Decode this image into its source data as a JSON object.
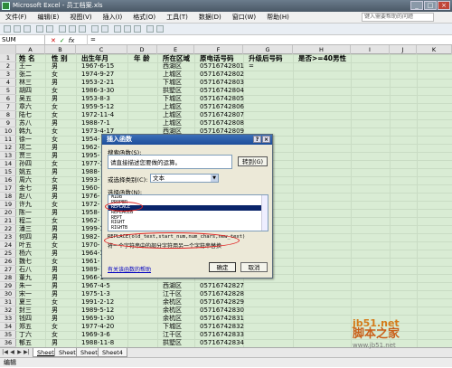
{
  "window": {
    "title": "Microsoft Excel - 员工档案.xls",
    "buttons": [
      "_",
      "□",
      "×"
    ]
  },
  "menu": {
    "items": [
      "文件(F)",
      "编辑(E)",
      "视图(V)",
      "插入(I)",
      "格式(O)",
      "工具(T)",
      "数据(D)",
      "窗口(W)",
      "帮助(H)"
    ],
    "help_placeholder": "键入需要帮助的问题"
  },
  "formula_bar": {
    "name_box": "SUM",
    "cancel": "✕",
    "enter": "✓",
    "fx": "fx",
    "content": "="
  },
  "columns": [
    "A",
    "B",
    "C",
    "D",
    "E",
    "F",
    "G",
    "H",
    "I",
    "J",
    "K"
  ],
  "row_numbers": [
    "1",
    "2",
    "3",
    "4",
    "5",
    "6",
    "7",
    "8",
    "9",
    "10",
    "11",
    "12",
    "13",
    "14",
    "15",
    "16",
    "17",
    "18",
    "19",
    "20",
    "21",
    "22",
    "23",
    "24",
    "25",
    "26",
    "27",
    "28",
    "29",
    "30",
    "31",
    "32",
    "33",
    "34",
    "35",
    "36"
  ],
  "header": {
    "a": "姓 名",
    "b": "性 别",
    "c": "出生年月",
    "d": "年 龄",
    "e": "所在区域",
    "f": "原电话号码",
    "g": "升级后号码",
    "h": "是否>=40男性"
  },
  "rows": [
    {
      "a": "王一",
      "b": "男",
      "c": "1967-6-15",
      "e": "西湖区",
      "f": "05716742801",
      "g": "="
    },
    {
      "a": "张二",
      "b": "女",
      "c": "1974-9-27",
      "e": "上城区",
      "f": "05716742802",
      "g": ""
    },
    {
      "a": "林三",
      "b": "男",
      "c": "1953-2-21",
      "e": "下城区",
      "f": "05716742803",
      "g": ""
    },
    {
      "a": "胡四",
      "b": "女",
      "c": "1986-3-30",
      "e": "拱墅区",
      "f": "05716742804",
      "g": ""
    },
    {
      "a": "吴五",
      "b": "男",
      "c": "1953-8-3",
      "e": "下城区",
      "f": "05716742805",
      "g": ""
    },
    {
      "a": "章六",
      "b": "女",
      "c": "1959-5-12",
      "e": "上城区",
      "f": "05716742806",
      "g": ""
    },
    {
      "a": "陆七",
      "b": "女",
      "c": "1972-11-4",
      "e": "上城区",
      "f": "05716742807",
      "g": ""
    },
    {
      "a": "苏八",
      "b": "男",
      "c": "1988-7-1",
      "e": "上城区",
      "f": "05716742808",
      "g": ""
    },
    {
      "a": "韩九",
      "b": "女",
      "c": "1973-4-17",
      "e": "西湖区",
      "f": "05716742809",
      "g": ""
    },
    {
      "a": "徐一",
      "b": "女",
      "c": "1954-",
      "e": "",
      "f": "",
      "g": ""
    },
    {
      "a": "项二",
      "b": "男",
      "c": "1962-",
      "e": "",
      "f": "",
      "g": ""
    },
    {
      "a": "贾三",
      "b": "男",
      "c": "1995-",
      "e": "",
      "f": "",
      "g": ""
    },
    {
      "a": "孙四",
      "b": "女",
      "c": "1977-1",
      "e": "",
      "f": "",
      "g": ""
    },
    {
      "a": "姚五",
      "b": "男",
      "c": "1988-",
      "e": "",
      "f": "",
      "g": ""
    },
    {
      "a": "周六",
      "b": "女",
      "c": "1993-",
      "e": "",
      "f": "",
      "g": ""
    },
    {
      "a": "金七",
      "b": "男",
      "c": "1960-",
      "e": "",
      "f": "",
      "g": ""
    },
    {
      "a": "赵八",
      "b": "男",
      "c": "1976-",
      "e": "",
      "f": "",
      "g": ""
    },
    {
      "a": "许九",
      "b": "女",
      "c": "1972-",
      "e": "",
      "f": "",
      "g": ""
    },
    {
      "a": "陈一",
      "b": "男",
      "c": "1958-",
      "e": "",
      "f": "",
      "g": ""
    },
    {
      "a": "程二",
      "b": "女",
      "c": "1962-",
      "e": "",
      "f": "",
      "g": ""
    },
    {
      "a": "潘三",
      "b": "男",
      "c": "1999-1",
      "e": "",
      "f": "",
      "g": ""
    },
    {
      "a": "何四",
      "b": "男",
      "c": "1982-",
      "e": "",
      "f": "",
      "g": ""
    },
    {
      "a": "叶五",
      "b": "女",
      "c": "1970-",
      "e": "",
      "f": "",
      "g": ""
    },
    {
      "a": "杨六",
      "b": "男",
      "c": "1964-1",
      "e": "",
      "f": "",
      "g": ""
    },
    {
      "a": "魏七",
      "b": "女",
      "c": "1961-",
      "e": "",
      "f": "",
      "g": ""
    },
    {
      "a": "石八",
      "b": "男",
      "c": "1989-",
      "e": "",
      "f": "",
      "g": ""
    },
    {
      "a": "董九",
      "b": "男",
      "c": "1966-1",
      "e": "",
      "f": "",
      "g": ""
    },
    {
      "a": "朱一",
      "b": "男",
      "c": "1967-4-5",
      "e": "西湖区",
      "f": "05716742827",
      "g": ""
    },
    {
      "a": "宋一",
      "b": "男",
      "c": "1975-1-3",
      "e": "江干区",
      "f": "05716742828",
      "g": ""
    },
    {
      "a": "夏三",
      "b": "女",
      "c": "1991-2-12",
      "e": "余杭区",
      "f": "05716742829",
      "g": ""
    },
    {
      "a": "封三",
      "b": "男",
      "c": "1989-5-12",
      "e": "余杭区",
      "f": "05716742830",
      "g": ""
    },
    {
      "a": "钱四",
      "b": "男",
      "c": "1969-1-30",
      "e": "余杭区",
      "f": "05716742831",
      "g": ""
    },
    {
      "a": "郑五",
      "b": "女",
      "c": "1977-4-20",
      "e": "下城区",
      "f": "05716742832",
      "g": ""
    },
    {
      "a": "丁六",
      "b": "女",
      "c": "1969-3-6",
      "e": "江干区",
      "f": "05716742833",
      "g": ""
    },
    {
      "a": "郁五",
      "b": "男",
      "c": "1988-11-8",
      "e": "拱墅区",
      "f": "05716742834",
      "g": ""
    },
    {
      "a": "刘八",
      "b": "女",
      "c": "1964-4-1",
      "e": "余杭区",
      "f": "05716742835",
      "g": ""
    }
  ],
  "sheet_tabs": [
    "Sheet1",
    "Sheet2",
    "Sheet3",
    "Sheet4"
  ],
  "status": "编辑",
  "dialog": {
    "title": "插入函数",
    "search_label": "搜索函数(S):",
    "search_text": "请直接描述您要做的运算。",
    "go_button": "转到(G)",
    "category_label": "或选择类别(C):",
    "category_value": "文本",
    "list_label": "选择函数(N):",
    "functions": [
      "MIDB",
      "PROPER",
      "REPLACE",
      "REPLACEB",
      "REPT",
      "RIGHT",
      "RIGHTB"
    ],
    "selected_function": "REPLACE",
    "syntax": "REPLACE(old_text,start_num,num_chars,new_text)",
    "description": "将一个字符串中的部分字符用另一个字符串替换",
    "help_link": "有关该函数的帮助",
    "ok": "确定",
    "cancel": "取消"
  },
  "watermark": {
    "line1": "jb51.net",
    "line2": "脚本之家",
    "line3": "www.jb51.net"
  }
}
